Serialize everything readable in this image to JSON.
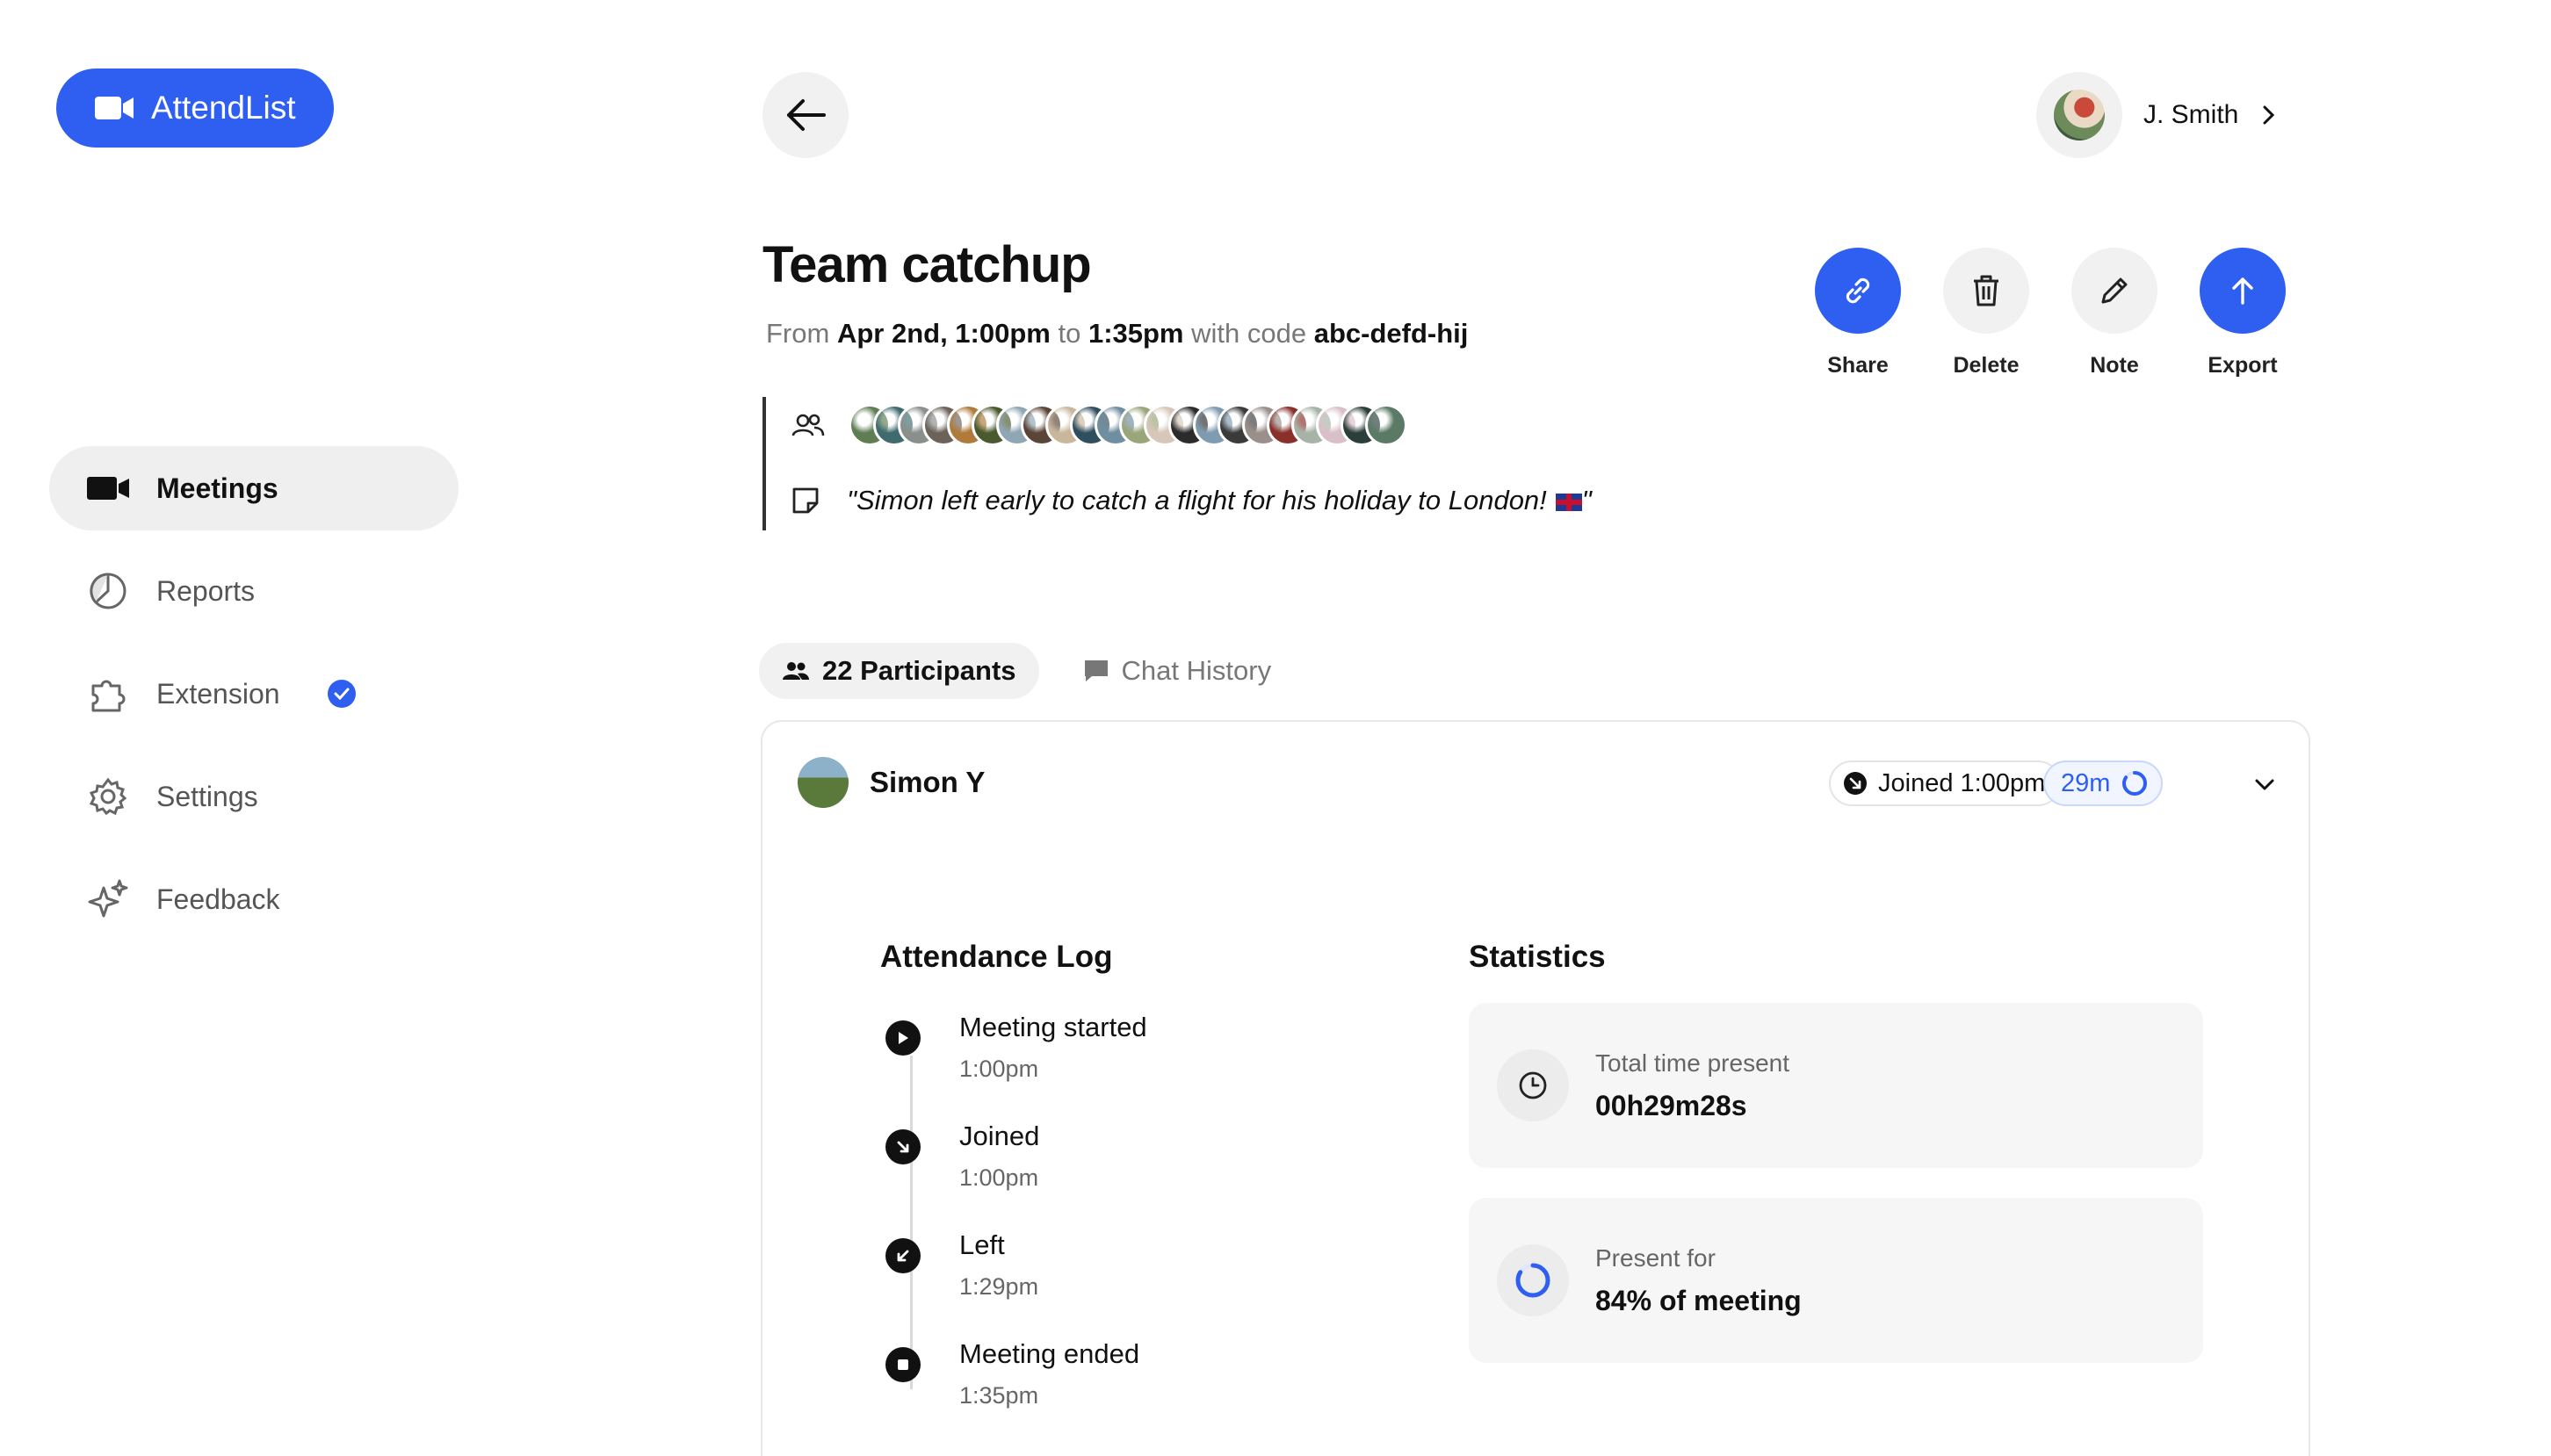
{
  "app": {
    "name": "AttendList",
    "accent": "#2f5ff0"
  },
  "sidebar": {
    "items": [
      {
        "label": "Meetings",
        "icon": "video-camera-icon",
        "active": true
      },
      {
        "label": "Reports",
        "icon": "pie-chart-icon"
      },
      {
        "label": "Extension",
        "icon": "puzzle-icon",
        "badge": "verified-check-icon"
      },
      {
        "label": "Settings",
        "icon": "gear-icon"
      },
      {
        "label": "Feedback",
        "icon": "sparkle-icon"
      }
    ]
  },
  "header": {
    "user_name": "J. Smith"
  },
  "meeting": {
    "title": "Team catchup",
    "from_word": "From",
    "start": "Apr 2nd, 1:00pm",
    "to_word": "to",
    "end": "1:35pm",
    "code_prefix": "with code",
    "code": "abc-defd-hij",
    "note": "\"Simon left early to catch a flight for his holiday to London! \"",
    "note_open": "\"Simon left early to catch a flight for his holiday to London!",
    "note_close": "\""
  },
  "actions": [
    {
      "label": "Share",
      "icon": "link-icon",
      "primary": true
    },
    {
      "label": "Delete",
      "icon": "trash-icon",
      "primary": false
    },
    {
      "label": "Note",
      "icon": "pencil-icon",
      "primary": false
    },
    {
      "label": "Export",
      "icon": "arrow-up-icon",
      "primary": true
    }
  ],
  "tabs": [
    {
      "label": "22 Participants",
      "icon": "people-icon",
      "active": true
    },
    {
      "label": "Chat History",
      "icon": "chat-icon",
      "active": false
    }
  ],
  "participant": {
    "name": "Simon Y",
    "joined": "Joined 1:00pm",
    "duration": "29m",
    "attendance_heading": "Attendance Log",
    "statistics_heading": "Statistics",
    "log": [
      {
        "event": "Meeting started",
        "time": "1:00pm",
        "icon": "play-icon"
      },
      {
        "event": "Joined",
        "time": "1:00pm",
        "icon": "arrow-down-right-icon"
      },
      {
        "event": "Left",
        "time": "1:29pm",
        "icon": "arrow-down-left-icon"
      },
      {
        "event": "Meeting ended",
        "time": "1:35pm",
        "icon": "stop-icon"
      }
    ],
    "stats": [
      {
        "label": "Total time present",
        "value": "00h29m28s",
        "icon": "clock-icon"
      },
      {
        "label": "Present for",
        "value": "84% of meeting",
        "icon": "progress-ring-icon",
        "fraction": 0.84
      }
    ]
  },
  "avatar_colors": [
    "#5e7d52",
    "#3f6b6e",
    "#8a8f8c",
    "#6b6258",
    "#b07a3a",
    "#4a5a2e",
    "#8fa6b5",
    "#5b4536",
    "#c9b79c",
    "#2f4e5e",
    "#6f8ea0",
    "#9aa57a",
    "#d8c7b8",
    "#2b2b2b",
    "#7f9bb0",
    "#3a3a3a",
    "#9a8f8a",
    "#8a2f2a",
    "#a8b3a8",
    "#d9c0c8",
    "#2c3e3a",
    "#5a7a66"
  ]
}
